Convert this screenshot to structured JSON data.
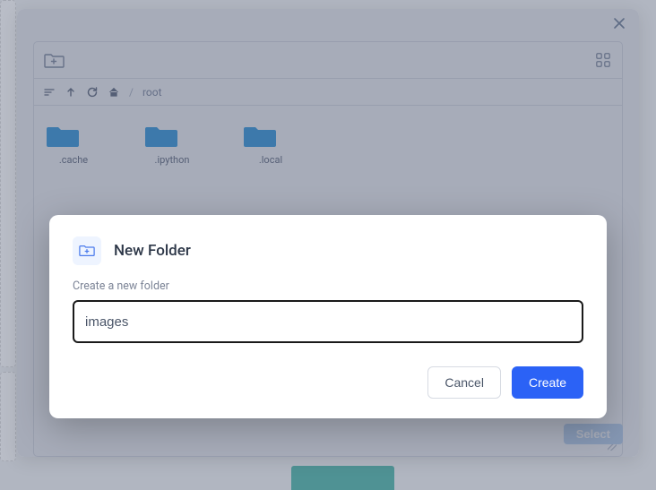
{
  "background": {
    "teal_bar": true
  },
  "file_dialog": {
    "nav": {
      "crumb_root": "root",
      "sort_icon": "sort-icon",
      "up_icon": "arrow-up-icon",
      "refresh_icon": "refresh-icon",
      "home_icon": "home-icon"
    },
    "toolbar": {
      "new_folder_icon": "folder-plus-icon",
      "grid_icon": "grid-icon"
    },
    "folders": [
      {
        "label": ".cache"
      },
      {
        "label": ".ipython"
      },
      {
        "label": ".local"
      }
    ],
    "select_label": "Select"
  },
  "new_folder_modal": {
    "title": "New Folder",
    "subtitle": "Create a new folder",
    "input_value": "images",
    "cancel_label": "Cancel",
    "create_label": "Create"
  }
}
